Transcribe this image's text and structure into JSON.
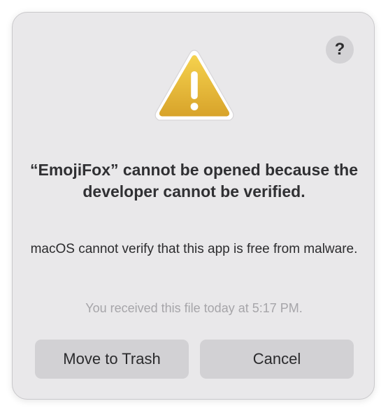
{
  "dialog": {
    "help_label": "?",
    "icon": "warning-triangle-icon",
    "title": "“EmojiFox” cannot be opened because the developer cannot be verified.",
    "message": "macOS cannot verify that this app is free from malware.",
    "received_note": "You received this file today at 5:17 PM.",
    "buttons": {
      "move_to_trash": "Move to Trash",
      "cancel": "Cancel"
    }
  },
  "colors": {
    "dialog_background": "#e9e8ea",
    "button_background": "#d2d1d4",
    "warning_fill_top": "#f3cf48",
    "warning_fill_bottom": "#d9a528",
    "warning_border": "#ffffff"
  }
}
